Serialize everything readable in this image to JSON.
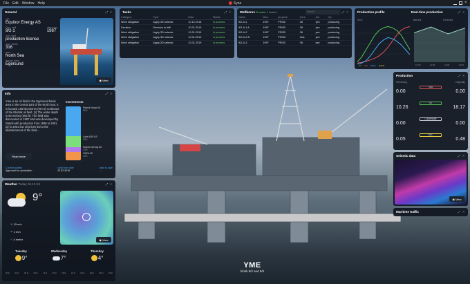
{
  "menubar": {
    "items": [
      "File",
      "Edit",
      "Window",
      "Help"
    ],
    "app_title": "Syna"
  },
  "general": {
    "title": "General",
    "operator_label": "OP",
    "operator": "Equinor Energy AS",
    "disc_well_label": "Disc. well",
    "disc_well": "9/2-1",
    "discovery_label": "discovery",
    "discovery": "1987",
    "license_label": "own. kind",
    "license": "production license",
    "own_name_label": "own. name",
    "own_name": "316",
    "area_label": "area",
    "area": "North Sea",
    "supply_label": "Supply base",
    "supply": "Egersund",
    "view": "View"
  },
  "info": {
    "title": "Info",
    "text": "Yme is an oil field in the Egersund basin area in the central part of the North Sea. It is located 160 kilometres (99 mi) northeast of the Ekofisk oil field. [1] The water depth is 93 metres (305 ft). The field was discovered in 1987 and was developed by Statoil with production from 1996 to 2001. [2] In 2001 low oil prices led to the abandonment of the field...",
    "read_more": "Read more",
    "investments_title": "Investments",
    "investments": [
      {
        "name": "Repsol Norge AS",
        "pct": "55%",
        "color": "#4aa8f0"
      },
      {
        "name": "Lotos E&P AS",
        "pct": "20%",
        "color": "#7be07b"
      },
      {
        "name": "Kufpec Norway AS",
        "pct": "10%",
        "color": "#b07be8"
      },
      {
        "name": "OKEA AS",
        "pct": "15%",
        "color": "#f2944a"
      }
    ],
    "activity_label": "Current activity",
    "activity": "Approved for production",
    "valid_from_label": "valid from date",
    "valid_from": "23.02.2016",
    "valid_to_label": "valid to date",
    "valid_to": "- -"
  },
  "weather": {
    "title": "Weather",
    "date": "Today 18.10.19",
    "temp": "9°",
    "wind": "10 m/s",
    "rain": "2 mm",
    "wave": "4 meter",
    "view": "View",
    "days": [
      {
        "day": "Tuesday",
        "temp": "9°"
      },
      {
        "day": "Wednesday",
        "temp": "7°"
      },
      {
        "day": "Thursday",
        "temp": "4°"
      }
    ],
    "hours": [
      "00 kl",
      "03 kl",
      "06 kl",
      "09 kl",
      "12 kl",
      "15 kl",
      "18 kl",
      "21 kl",
      "00 kl",
      "03 kl",
      "06 kl",
      "09 kl"
    ]
  },
  "tasks": {
    "title": "Tasks",
    "headers": [
      "Category",
      "Type",
      "Date",
      "Status"
    ],
    "rows": [
      [
        "Work obligation",
        "Apply 3D seismic",
        "10.12.2018",
        "In process"
      ],
      [
        "Decision",
        "Decision to drill",
        "10.01.2019",
        "In process"
      ],
      [
        "Work obligation",
        "Apply 3D seismic",
        "10.01.2019",
        "In process"
      ],
      [
        "Work obligation",
        "Apply 3D seismic",
        "10.01.2019",
        "In process"
      ],
      [
        "Work obligation",
        "Apply 3D seismic",
        "10.01.2019",
        "In process"
      ]
    ]
  },
  "wellbores": {
    "title": "Wellbores",
    "subtitle": "26 active",
    "subtitle2": "4 inactive",
    "search_placeholder": "Search",
    "headers": [
      "Name",
      "Disc.",
      "purpose",
      "Cont.",
      "act.",
      "Op."
    ],
    "rows": [
      [
        "9/2-A-1",
        "1997",
        "PROD",
        "Oil",
        "yes",
        "producing"
      ],
      [
        "9/2-A-1 A",
        "1997",
        "PROD",
        "Oil",
        "yes",
        "producing"
      ],
      [
        "9/2-A-2",
        "1997",
        "PROD",
        "Oil",
        "yes",
        "producing"
      ],
      [
        "9/2-A-2 B",
        "1997",
        "PROD",
        "Gas",
        "yes",
        "producing"
      ],
      [
        "9/2-A-3",
        "1997",
        "PROD",
        "Oil",
        "yes",
        "producing"
      ]
    ]
  },
  "production_profile": {
    "title": "Production profile",
    "unit": "Sm3",
    "legend": [
      "Oil",
      "Gas",
      "Water",
      "Solids"
    ]
  },
  "realtime": {
    "title": "Real-time production",
    "unit": "Barrels",
    "forecast": "Forecast",
    "ticks": [
      "10:00",
      "11:00",
      "12:00",
      "13:00"
    ]
  },
  "production": {
    "title": "Production",
    "remaining_label": "Remaining",
    "original_label": "Originally",
    "rows": [
      {
        "name": "Gas",
        "remaining": "0.00",
        "original": "0.00",
        "color": "#e05555"
      },
      {
        "name": "Oil",
        "remaining": "10.26",
        "original": "18.17",
        "color": "#57c457"
      },
      {
        "name": "Condensate",
        "remaining": "0.00",
        "original": "0.00",
        "color": "#cfd3d8"
      },
      {
        "name": "NGL",
        "remaining": "0.05",
        "original": "0.48",
        "color": "#f0d23c"
      }
    ]
  },
  "seismic": {
    "title": "Seismic data",
    "view": "View"
  },
  "maritime": {
    "title": "Maritime traffic"
  },
  "field": {
    "name": "YME",
    "sub": "blokk 9/2 and 9/5"
  },
  "chart_data": [
    {
      "type": "area",
      "title": "Production profile",
      "ylabel": "Sm3",
      "x": [
        1996,
        1998,
        2000,
        2002,
        2004,
        2006,
        2008,
        2010,
        2012,
        2014,
        2016,
        2018,
        2020
      ],
      "series": [
        {
          "name": "Oil",
          "values": [
            10,
            30,
            60,
            90,
            120,
            140,
            150,
            155,
            150,
            140,
            120,
            90,
            60
          ]
        },
        {
          "name": "Gas",
          "values": [
            5,
            8,
            12,
            18,
            25,
            35,
            50,
            70,
            95,
            120,
            140,
            150,
            155
          ]
        },
        {
          "name": "Water",
          "values": [
            0,
            5,
            15,
            35,
            60,
            85,
            100,
            110,
            105,
            95,
            80,
            60,
            40
          ]
        }
      ]
    },
    {
      "type": "area",
      "title": "Real-time production",
      "ylabel": "Barrels",
      "x": [
        "10:00",
        "11:00",
        "12:00",
        "13:00"
      ],
      "series": [
        {
          "name": "Barrels",
          "values": [
            60,
            72,
            58,
            70
          ]
        }
      ]
    }
  ]
}
